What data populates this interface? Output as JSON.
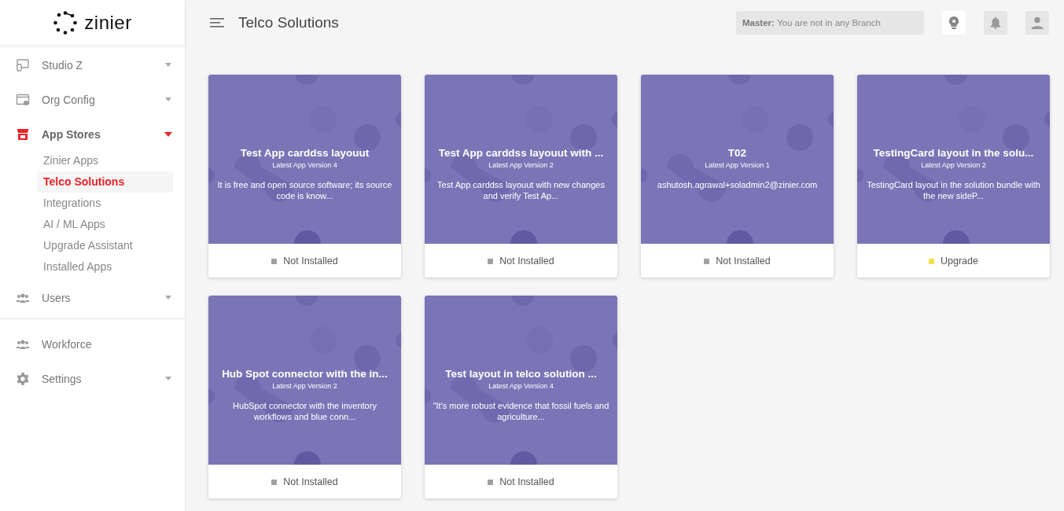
{
  "logo": {
    "text": "zinier"
  },
  "sidebar": {
    "sections": [
      {
        "items": [
          {
            "label": "Studio Z",
            "kind": "group",
            "selected": false,
            "expanded": false
          },
          {
            "label": "Org Config",
            "kind": "group",
            "selected": false,
            "expanded": false
          },
          {
            "label": "App Stores",
            "kind": "group",
            "selected": true,
            "expanded": true,
            "children": [
              {
                "label": "Zinier Apps",
                "selected": false
              },
              {
                "label": "Telco Solutions",
                "selected": true
              },
              {
                "label": "Integrations",
                "selected": false
              },
              {
                "label": "AI / ML Apps",
                "selected": false
              },
              {
                "label": "Upgrade Assistant",
                "selected": false
              },
              {
                "label": "Installed Apps",
                "selected": false
              }
            ]
          },
          {
            "label": "Users",
            "kind": "group",
            "selected": false,
            "expanded": false
          }
        ]
      },
      {
        "items": [
          {
            "label": "Workforce",
            "kind": "link",
            "selected": false
          },
          {
            "label": "Settings",
            "kind": "group",
            "selected": false,
            "expanded": false
          }
        ]
      }
    ]
  },
  "header": {
    "title": "Telco Solutions",
    "branch": {
      "label": "Master:",
      "value": "You are not in any Branch"
    }
  },
  "cards": [
    {
      "title": "Test App carddss layouut",
      "version": "Latest App Version 4",
      "description": "It is free and open source software; its source code is know...",
      "status": "Not Installed",
      "color": "#a0a0a0"
    },
    {
      "title": "Test App carddss layouut with ...",
      "version": "Latest App Version 2",
      "description": "Test App carddss layouut with new changes and verify Test Ap...",
      "status": "Not Installed",
      "color": "#a0a0a0"
    },
    {
      "title": "T02",
      "version": "Latest App Version 1",
      "description": "ashutosh.agrawal+soladmin2@zinier.com",
      "status": "Not Installed",
      "color": "#a0a0a0"
    },
    {
      "title": "TestingCard layout in the solu...",
      "version": "Latest App Version 2",
      "description": "TestingCard layout in the solution bundle with the new sideP...",
      "status": "Upgrade",
      "color": "#f5e04a"
    },
    {
      "title": "Hub Spot connector with the in...",
      "version": "Latest App Version 2",
      "description": "HubSpot connector with the inventory workflows and blue conn...",
      "status": "Not Installed",
      "color": "#a0a0a0"
    },
    {
      "title": "Test layout in telco solution ...",
      "version": "Latest App Version 4",
      "description": "\"It's more robust evidence that fossil fuels and agriculture...",
      "status": "Not Installed",
      "color": "#a0a0a0"
    }
  ]
}
